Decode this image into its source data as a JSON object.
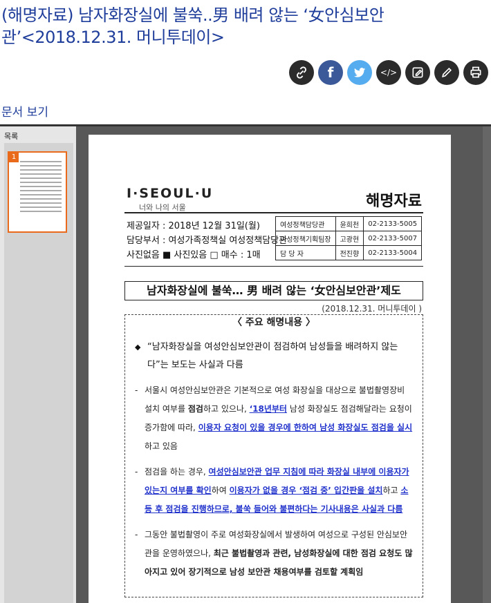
{
  "title": "(해명자료) 남자화장실에 불쑥..男 배려 않는 ‘女안심보안관’<2018.12.31. 머니투데이>",
  "share_buttons": [
    {
      "icon": "link-icon",
      "label": "🔗"
    },
    {
      "icon": "facebook-icon",
      "label": "f"
    },
    {
      "icon": "twitter-icon",
      "label": ""
    },
    {
      "icon": "embed-icon",
      "label": "</>"
    },
    {
      "icon": "edit-icon",
      "label": "✎"
    },
    {
      "icon": "pencil-icon",
      "label": "✏"
    },
    {
      "icon": "print-icon",
      "label": ""
    }
  ],
  "doc_view_link": "문서 보기",
  "viewer": {
    "sidebar_label": "목록",
    "thumb_number": "1"
  },
  "document": {
    "logo": "I·SEOUL·U",
    "logo_sub": "너와 나의 서울",
    "doc_type": "해명자료",
    "info_rows": [
      "제공일자 : 2018년 12월 31일(월)",
      "담당부서 : 여성가족정책실 여성정책담당관",
      "사진없음 ■ 사진있음 □ 매수 : 1매"
    ],
    "contacts": [
      {
        "role": "여성정책담당관",
        "name": "윤희천",
        "phone": "02-2133-5005"
      },
      {
        "role": "여성정책기획팀장",
        "name": "고광현",
        "phone": "02-2133-5007"
      },
      {
        "role": "담 당 자",
        "name": "전진향",
        "phone": "02-2133-5004"
      }
    ],
    "headline": "남자화장실에 불쑥… 男 배려 않는 ‘女안심보안관’제도",
    "headline_date": "(2018.12.31. 머니투데이 )",
    "main_points_title": "〈 주요 해명내용 〉",
    "lead_point": "“남자화장실을 여성안심보안관이 점검하여 남성들을 배려하지 않는다”는 보도는 사실과 다름",
    "para1": {
      "plain1": "서울시 여성안심보안관은 기본적으로 여성 화장실을 대상으로 불법촬영장비 설치 여부를 ",
      "bold1": "점검",
      "plain2": "하고 있으나, ",
      "ul1": "‘18년부터",
      "plain3": " 남성 화장실도 점검해달라는 요청이 증가함에 따라, ",
      "ul2": "이용자 요청이 있을 경우에 한하여 남성 화장실도 점검을 실시",
      "plain4": "하고 있음"
    },
    "para2": {
      "plain1": "점검을 하는 경우, ",
      "ul1": "여성안심보안관 업무 지침에 따라 화장실 내부에 이용자가 있는지 여부를 확인",
      "plain2": "하여 ",
      "ul2": "이용자가 없을 경우 ‘점검 중’ 입간판을 설치",
      "plain3": "하고 ",
      "ul3": "소등 후 점검을 진행하므로, 불쑥 들어와 불편하다는 기사내용은 사실과 다름"
    },
    "para3": {
      "plain1": "그동안 불법촬영이 주로 여성화장실에서 발생하여 여성으로 구성된 안심보안관을 운영하였으나, ",
      "bold1": "최근 불법촬영과 관련, 남성화장실에 대한 점검 요청도 많아지고 있어 장기적으로 남성 보안관 채용여부를 검토할 계획임"
    }
  }
}
